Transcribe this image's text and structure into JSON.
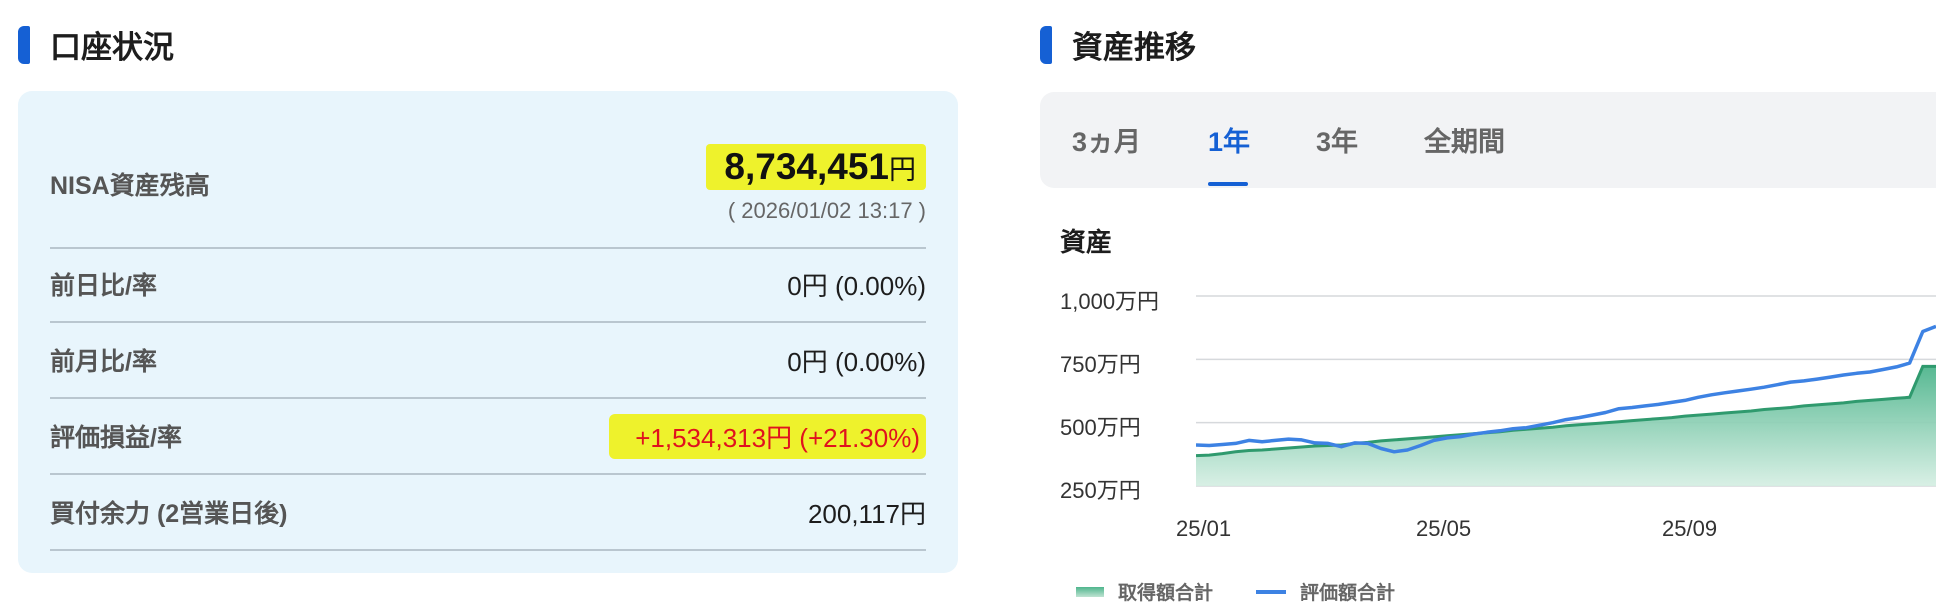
{
  "account": {
    "title": "口座状況",
    "nisa_label": "NISA資産残高",
    "nisa_value": "8,734,451",
    "nisa_unit": "円",
    "timestamp": "( 2026/01/02 13:17 )",
    "rows": [
      {
        "label": "前日比/率",
        "value": "0円 (0.00%)"
      },
      {
        "label": "前月比/率",
        "value": "0円 (0.00%)"
      },
      {
        "label": "評価損益/率",
        "value": "+1,534,313円 (+21.30%)"
      },
      {
        "label": "買付余力 (2営業日後)",
        "value": "200,117円"
      }
    ]
  },
  "assets": {
    "title": "資産推移",
    "tabs": [
      "3ヵ月",
      "1年",
      "3年",
      "全期間"
    ],
    "active_tab": "1年",
    "chart_title": "資産"
  },
  "chart_data": {
    "type": "area",
    "ylim": [
      250,
      1000
    ],
    "y_ticks": [
      "1,000万円",
      "750万円",
      "500万円",
      "250万円"
    ],
    "y_tick_values": [
      1000,
      750,
      500,
      250
    ],
    "x_ticks": [
      "25/01",
      "25/05",
      "25/09"
    ],
    "colors": {
      "acquisition": "#4fb58d",
      "valuation": "#3d82e3"
    },
    "series": [
      {
        "name": "取得額合計",
        "values": [
          370,
          372,
          378,
          385,
          390,
          392,
          396,
          400,
          404,
          408,
          410,
          412,
          418,
          422,
          428,
          432,
          436,
          440,
          444,
          448,
          452,
          456,
          460,
          464,
          470,
          474,
          478,
          482,
          488,
          492,
          496,
          500,
          504,
          508,
          512,
          516,
          520,
          526,
          530,
          534,
          538,
          542,
          546,
          552,
          556,
          560,
          566,
          570,
          574,
          578,
          584,
          588,
          592,
          596,
          600,
          722,
          722
        ]
      },
      {
        "name": "評価額合計",
        "values": [
          412,
          410,
          414,
          418,
          430,
          425,
          430,
          435,
          432,
          420,
          418,
          405,
          420,
          418,
          398,
          385,
          392,
          410,
          430,
          440,
          445,
          455,
          462,
          468,
          476,
          480,
          490,
          500,
          512,
          520,
          530,
          540,
          555,
          560,
          566,
          572,
          580,
          588,
          600,
          610,
          618,
          625,
          632,
          640,
          650,
          660,
          665,
          672,
          680,
          688,
          695,
          700,
          710,
          720,
          735,
          860,
          880
        ]
      }
    ]
  }
}
